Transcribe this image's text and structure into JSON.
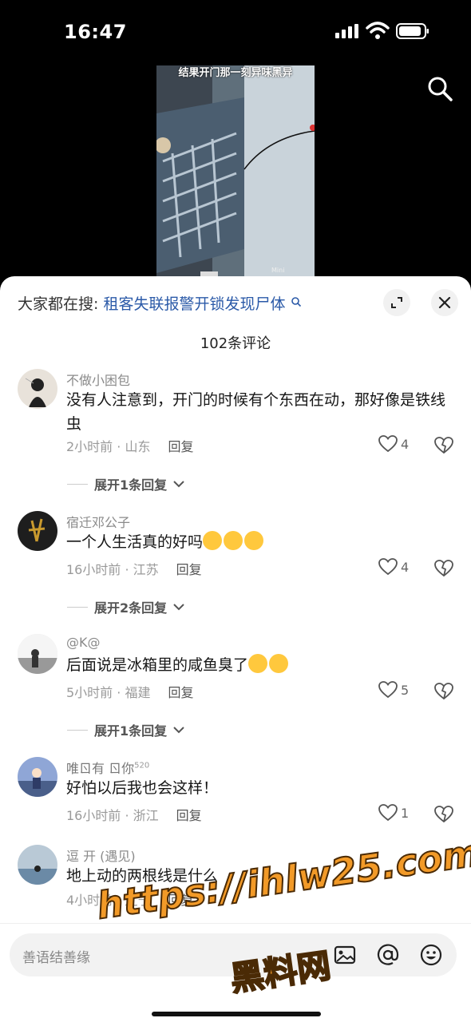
{
  "status": {
    "time": "16:47"
  },
  "video": {
    "overlay_text": "结果开门那一刻异味黑异",
    "logo_text": "Mini"
  },
  "sheet": {
    "hot_search_label": "大家都在搜:",
    "hot_search_keyword": "租客失联报警开锁发现尸体",
    "comment_count": "102条评论"
  },
  "comments": [
    {
      "user": "不做小困包",
      "text": "没有人注意到，开门的时候有个东西在动，那好像是铁线虫",
      "time_loc": "2小时前 · 山东",
      "reply": "回复",
      "likes": "4",
      "expand": "展开1条回复"
    },
    {
      "user": "宿迁邓公子",
      "text": "一个人生活真的好吗",
      "time_loc": "16小时前 · 江苏",
      "reply": "回复",
      "likes": "4",
      "expand": "展开2条回复"
    },
    {
      "user": "@K@",
      "text": "后面说是冰箱里的咸鱼臭了",
      "time_loc": "5小时前 · 福建",
      "reply": "回复",
      "likes": "5",
      "expand": "展开1条回复"
    },
    {
      "user": "唯ㄖ有 ㄖ你",
      "user_sup": "520",
      "text": "好怕以后我也会这样！",
      "time_loc": "16小时前 · 浙江",
      "reply": "回复",
      "likes": "1"
    },
    {
      "user": "逗 开 (遇见)",
      "text": "地上动的两根线是什么",
      "time_loc": "4小时前 · 辽宁",
      "reply": "回复"
    }
  ],
  "input": {
    "placeholder": "善语结善缘"
  },
  "watermark": {
    "line1": "https://ihlw25.com",
    "line2": "黑料网"
  },
  "colors": {
    "keyword": "#2b5aa8",
    "watermark": "#f29a28"
  }
}
